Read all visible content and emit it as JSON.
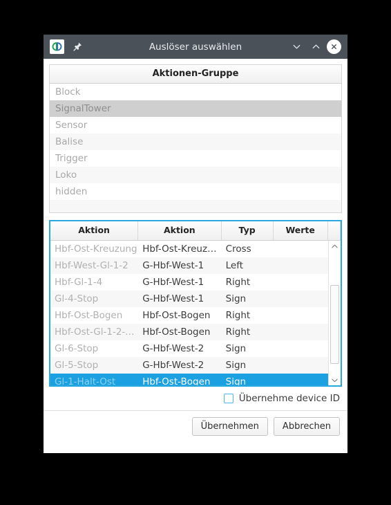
{
  "window": {
    "title": "Auslöser auswählen",
    "app_icon": "cb-logo-icon",
    "pin_icon": "pin-icon",
    "minimize_icon": "chevron-down-icon",
    "maximize_icon": "chevron-up-icon",
    "close_icon": "close-icon",
    "titlebar_color": "#4a5159"
  },
  "group_panel": {
    "header": "Aktionen-Gruppe",
    "items": [
      {
        "label": "Block",
        "selected": false
      },
      {
        "label": "SignalTower",
        "selected": true
      },
      {
        "label": "Sensor",
        "selected": false
      },
      {
        "label": "Balise",
        "selected": false
      },
      {
        "label": "Trigger",
        "selected": false
      },
      {
        "label": "Loko",
        "selected": false
      },
      {
        "label": "hidden",
        "selected": false
      },
      {
        "label": "",
        "selected": false
      },
      {
        "label": "",
        "selected": false
      }
    ]
  },
  "action_table": {
    "focus_color": "#2aa8e0",
    "selection_color": "#1ba1e2",
    "columns": [
      "Aktion",
      "Aktion",
      "Typ",
      "Werte"
    ],
    "rows": [
      {
        "aktion1": "Hbf-Ost-Kreuzung",
        "aktion2": "Hbf-Ost-Kreuzung",
        "typ": "Cross",
        "werte": "",
        "selected": false
      },
      {
        "aktion1": "Hbf-West-Gl-1-2",
        "aktion2": "G-Hbf-West-1",
        "typ": "Left",
        "werte": "",
        "selected": false
      },
      {
        "aktion1": "Hbf-Gl-1-4",
        "aktion2": "G-Hbf-West-1",
        "typ": "Right",
        "werte": "",
        "selected": false
      },
      {
        "aktion1": "Gl-4-Stop",
        "aktion2": "G-Hbf-West-1",
        "typ": "Sign",
        "werte": "",
        "selected": false
      },
      {
        "aktion1": "Hbf-Ost-Bogen",
        "aktion2": "Hbf-Ost-Bogen",
        "typ": "Right",
        "werte": "",
        "selected": false
      },
      {
        "aktion1": "Hbf-Ost-Gl-1-2-Au...",
        "aktion2": "Hbf-Ost-Bogen",
        "typ": "Right",
        "werte": "",
        "selected": false
      },
      {
        "aktion1": "Gl-6-Stop",
        "aktion2": "G-Hbf-West-2",
        "typ": "Sign",
        "werte": "",
        "selected": false
      },
      {
        "aktion1": "Gl-5-Stop",
        "aktion2": "G-Hbf-West-2",
        "typ": "Sign",
        "werte": "",
        "selected": false
      },
      {
        "aktion1": "Gl-1-Halt-Ost",
        "aktion2": "Hbf-Ost-Bogen",
        "typ": "Sign",
        "werte": "",
        "selected": true
      }
    ],
    "scrollbar": {
      "up_icon": "chevron-up-icon",
      "down_icon": "chevron-down-icon"
    }
  },
  "options": {
    "device_id_label": "Übernehme device ID",
    "device_id_checked": false
  },
  "footer": {
    "apply_label": "Übernehmen",
    "cancel_label": "Abbrechen"
  }
}
